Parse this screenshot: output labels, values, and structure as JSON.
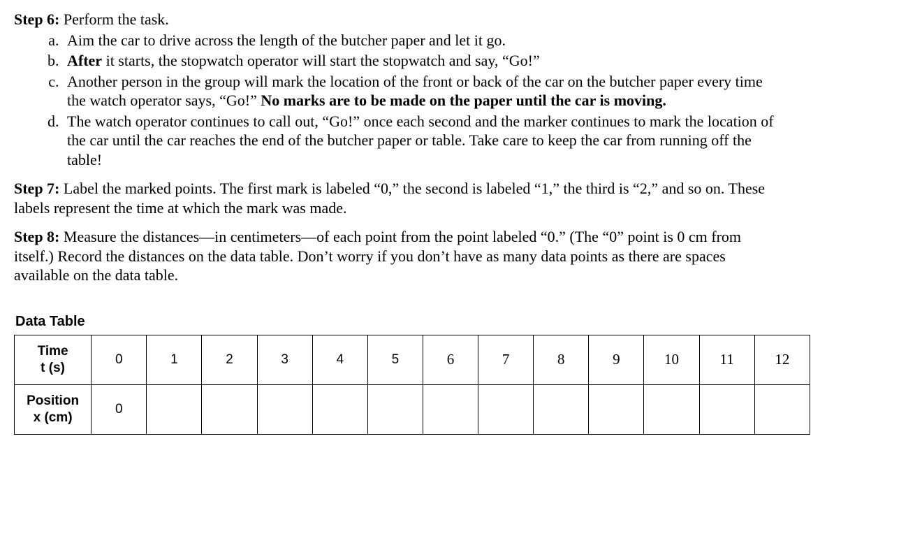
{
  "step6": {
    "label": "Step 6:",
    "title": " Perform the task.",
    "items": {
      "a": "Aim the car to drive across the length of the butcher paper and let it go.",
      "b_bold": "After",
      "b_rest": " it starts, the stopwatch operator will start the stopwatch and say, “Go!”",
      "c_part1": "Another person in the group will mark the location of the front or back of the car on the butcher paper every time the watch operator says, “Go!” ",
      "c_bold": "No marks are to be made on the paper until the car is moving.",
      "d": "The watch operator continues to call out, “Go!” once each second and the marker continues to mark the location of the car until the car reaches the end of the butcher paper or table. Take care to keep the car from running off the table!"
    }
  },
  "step7": {
    "label": "Step 7:",
    "text": " Label the marked points. The first mark is labeled “0,” the second is labeled “1,” the third is “2,” and so on. These labels represent the time at which the mark was made."
  },
  "step8": {
    "label": "Step 8:",
    "text": " Measure the distances—in centimeters—of each point from the point labeled “0.” (The “0” point is 0 cm from itself.) Record the distances on the data table. Don’t worry if you don’t have as many data points as there are spaces available on the data table."
  },
  "dataTable": {
    "title": "Data Table",
    "row1Header_l1": "Time",
    "row1Header_l2": "t (s)",
    "row2Header_l1": "Position",
    "row2Header_l2": "x (cm)",
    "times": [
      "0",
      "1",
      "2",
      "3",
      "4",
      "5",
      "6",
      "7",
      "8",
      "9",
      "10",
      "11",
      "12"
    ],
    "positions": [
      "0",
      "",
      "",
      "",
      "",
      "",
      "",
      "",
      "",
      "",
      "",
      "",
      ""
    ]
  },
  "chart_data": {
    "type": "table",
    "title": "Data Table",
    "columns": [
      "Time t (s)",
      "Position x (cm)"
    ],
    "rows": [
      {
        "t_s": 0,
        "x_cm": 0
      },
      {
        "t_s": 1,
        "x_cm": null
      },
      {
        "t_s": 2,
        "x_cm": null
      },
      {
        "t_s": 3,
        "x_cm": null
      },
      {
        "t_s": 4,
        "x_cm": null
      },
      {
        "t_s": 5,
        "x_cm": null
      },
      {
        "t_s": 6,
        "x_cm": null
      },
      {
        "t_s": 7,
        "x_cm": null
      },
      {
        "t_s": 8,
        "x_cm": null
      },
      {
        "t_s": 9,
        "x_cm": null
      },
      {
        "t_s": 10,
        "x_cm": null
      },
      {
        "t_s": 11,
        "x_cm": null
      },
      {
        "t_s": 12,
        "x_cm": null
      }
    ]
  }
}
